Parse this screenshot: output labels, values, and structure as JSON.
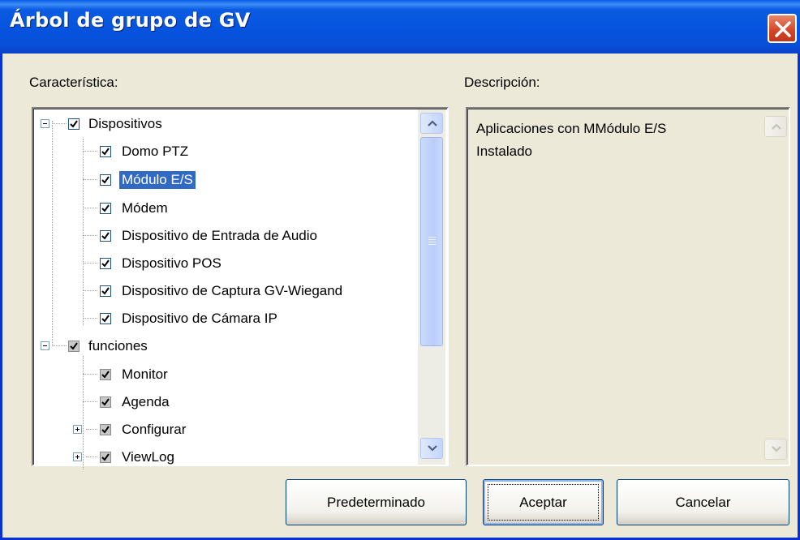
{
  "window": {
    "title": "Árbol de grupo de GV"
  },
  "labels": {
    "feature": "Característica:",
    "description": "Descripción:"
  },
  "tree": {
    "groups": [
      {
        "label": "Dispositivos",
        "checked": true,
        "expanded": true,
        "children": [
          {
            "label": "Domo PTZ",
            "checked": true
          },
          {
            "label": "Módulo E/S",
            "checked": true,
            "selected": true
          },
          {
            "label": "Módem",
            "checked": true
          },
          {
            "label": "Dispositivo de Entrada de Audio",
            "checked": true
          },
          {
            "label": "Dispositivo POS",
            "checked": true
          },
          {
            "label": "Dispositivo de Captura GV-Wiegand",
            "checked": true
          },
          {
            "label": "Dispositivo de Cámara IP",
            "checked": true
          }
        ]
      },
      {
        "label": "funciones",
        "checked": true,
        "expanded": true,
        "children": [
          {
            "label": "Monitor",
            "checked": true,
            "grey": true
          },
          {
            "label": "Agenda",
            "checked": true,
            "grey": true
          },
          {
            "label": "Configurar",
            "checked": true,
            "grey": true,
            "collapsed": true
          },
          {
            "label": "ViewLog",
            "checked": true,
            "grey": true,
            "collapsed": true
          }
        ]
      }
    ]
  },
  "description": {
    "line1": "Aplicaciones con MMódulo E/S",
    "line2": "Instalado"
  },
  "buttons": {
    "default": "Predeterminado",
    "accept": "Aceptar",
    "cancel": "Cancelar"
  },
  "colors": {
    "title_bar": "#0553de",
    "selection": "#316ac5",
    "close": "#d5492a"
  }
}
